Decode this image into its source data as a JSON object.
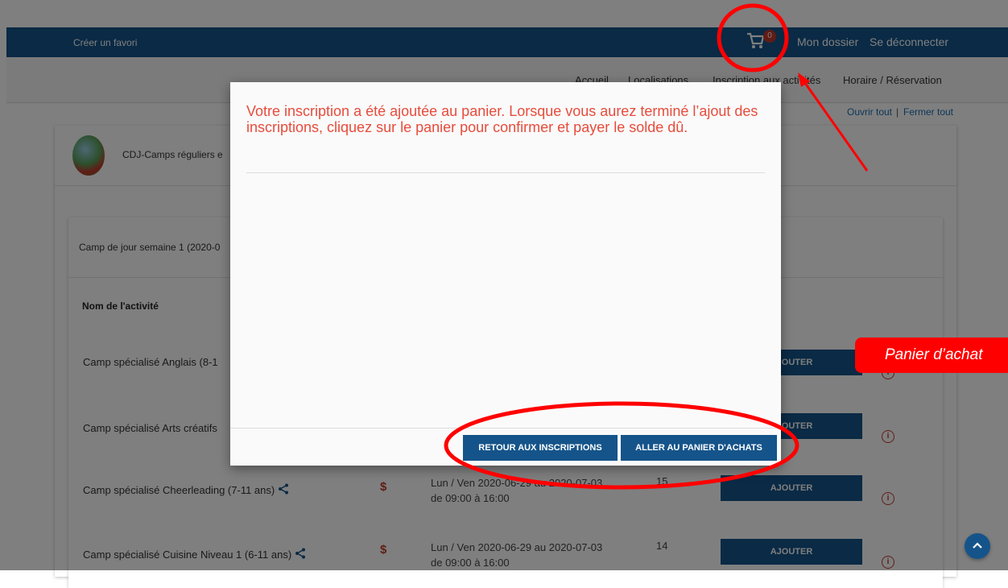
{
  "topbar": {
    "favorite_link": "Créer un favori",
    "cart_count": "0",
    "my_file": "Mon dossier",
    "logout": "Se déconnecter"
  },
  "nav": {
    "items": [
      "Accueil",
      "Localisations",
      "Inscription aux activités",
      "Horaire / Réservation"
    ]
  },
  "expand": {
    "open_all": "Ouvrir tout",
    "separator": "|",
    "close_all": "Fermer tout"
  },
  "card": {
    "title": "CDJ-Camps réguliers e"
  },
  "section": {
    "title": "Camp de jour semaine 1 (2020-0"
  },
  "table": {
    "column_name": "Nom de l'activité",
    "rows": [
      {
        "name": "Camp spécialisé Anglais (8-1",
        "price_icon": "",
        "schedule1": "",
        "schedule2": "",
        "spots": "",
        "button": "AJOUTER"
      },
      {
        "name": "Camp spécialisé Arts créatifs",
        "price_icon": "",
        "schedule1": "",
        "schedule2": "",
        "spots": "",
        "button": "AJOUTER"
      },
      {
        "name": "Camp spécialisé Cheerleading (7-11 ans)",
        "price_icon": "$",
        "schedule1": "Lun / Ven 2020-06-29 au 2020-07-03",
        "schedule2": "de 09:00 à 16:00",
        "spots": "15",
        "button": "AJOUTER"
      },
      {
        "name": "Camp spécialisé Cuisine Niveau 1 (6-11 ans)",
        "price_icon": "$",
        "schedule1": "Lun / Ven 2020-06-29 au 2020-07-03",
        "schedule2": "de 09:00 à 16:00",
        "spots": "14",
        "button": "AJOUTER"
      }
    ]
  },
  "modal": {
    "message": "Votre inscription a été ajoutée au panier. Lorsque vous aurez terminé l’ajout des inscriptions, cliquez sur le panier pour confirmer et payer le solde dû.",
    "back_button": "RETOUR AUX INSCRIPTIONS",
    "cart_button": "ALLER AU PANIER D'ACHATS"
  },
  "annotation": {
    "callout": "Panier d’achat"
  },
  "icons": {
    "cart": "shopping-cart-icon",
    "share": "share-icon",
    "info": "info-icon",
    "scroll_top": "chevron-up-icon"
  },
  "colors": {
    "primary": "#15548a",
    "accent_red": "#e74c3c",
    "annotation_red": "#ff0000"
  }
}
